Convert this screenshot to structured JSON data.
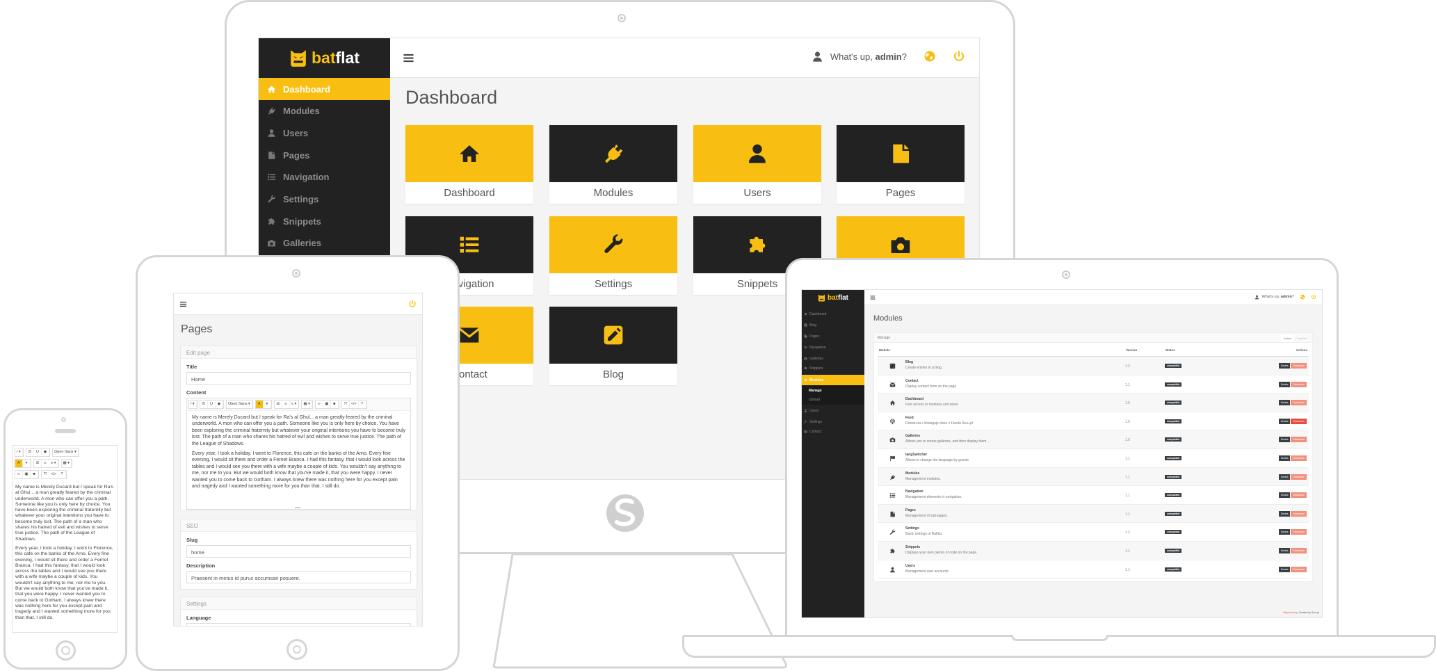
{
  "colors": {
    "accent": "#f8bf12",
    "dark": "#222222",
    "device_frame": "#d5d5d5",
    "deactivate": "#f0907e",
    "deactivate_strong": "#e74c3c"
  },
  "brand": {
    "part1": "bat",
    "part2": "flat"
  },
  "monitor": {
    "sidebar": [
      {
        "label": "Dashboard",
        "icon": "home",
        "active": true
      },
      {
        "label": "Modules",
        "icon": "plug"
      },
      {
        "label": "Users",
        "icon": "user"
      },
      {
        "label": "Pages",
        "icon": "file"
      },
      {
        "label": "Navigation",
        "icon": "list"
      },
      {
        "label": "Settings",
        "icon": "wrench"
      },
      {
        "label": "Snippets",
        "icon": "puzzle"
      },
      {
        "label": "Galleries",
        "icon": "camera"
      }
    ],
    "header": {
      "greeting_prefix": "What's up, ",
      "username": "admin",
      "greeting_suffix": "?",
      "user_icon": "user",
      "globe_icon": "globe",
      "power_icon": "power"
    },
    "title": "Dashboard",
    "tiles": [
      {
        "label": "Dashboard",
        "icon": "home",
        "style": "yellow"
      },
      {
        "label": "Modules",
        "icon": "plug",
        "style": "dark"
      },
      {
        "label": "Users",
        "icon": "user",
        "style": "yellow"
      },
      {
        "label": "Pages",
        "icon": "file",
        "style": "dark"
      },
      {
        "label": "Navigation",
        "icon": "list",
        "style": "dark"
      },
      {
        "label": "Settings",
        "icon": "wrench",
        "style": "yellow"
      },
      {
        "label": "Snippets",
        "icon": "puzzle",
        "style": "dark"
      },
      {
        "label": "Galleries",
        "icon": "camera",
        "style": "yellow"
      },
      {
        "label": "Contact",
        "icon": "envelope",
        "style": "yellow"
      },
      {
        "label": "Blog",
        "icon": "pencil",
        "style": "dark"
      }
    ]
  },
  "editor": {
    "font_label": "Open Sans",
    "paragraphs": [
      "My name is Merely Ducard but I speak for Ra's al Ghul... a man greatly feared by the criminal underworld. A mon who can offer you a path. Someone like you is only here by choice. You have been exploring the criminal fraternity but whatever your original intentions you have to become truly lost. The path of a man who shares his hatred of evil and wishes to serve true justice. The path of the League of Shadows.",
      "Every year, I took a holiday. I went to Florence, this cafe on the banks of the Arno. Every fine evening, I would sit there and order a Fernet Branca. I had this fantasy, that I would look across the tables and I would see you there with a wife maybe a couple of kids. You wouldn't say anything to me, nor me to you. But we would both know that you've made it, that you were happy. I never wanted you to come back to Gotham. I always knew there was nothing here for you except pain and tragedy and I wanted something more for you than that. I still do."
    ],
    "toolbar": [
      [
        {
          "icon": "magic",
          "caret": true
        }
      ],
      [
        {
          "text": "B"
        },
        {
          "text": "U"
        },
        {
          "icon": "eraser"
        }
      ],
      [
        {
          "text": "Open Sans",
          "caret": true
        }
      ],
      [
        {
          "text": "A",
          "highlight": true
        },
        {
          "caret": true
        }
      ],
      [
        {
          "icon": "unordered-list"
        },
        {
          "icon": "ordered-list"
        },
        {
          "icon": "align",
          "caret": true
        }
      ],
      [
        {
          "icon": "table",
          "caret": true
        }
      ],
      [
        {
          "icon": "link"
        },
        {
          "icon": "picture"
        },
        {
          "icon": "video"
        }
      ],
      [
        {
          "icon": "fullscreen"
        },
        {
          "text": "</>"
        },
        {
          "text": "?"
        }
      ]
    ]
  },
  "tablet": {
    "title": "Pages",
    "edit_panel": {
      "heading": "Edit page",
      "title_label": "Title",
      "title_value": "Home",
      "content_label": "Content"
    },
    "seo_panel": {
      "heading": "SEO",
      "slug_label": "Slug",
      "slug_value": "home",
      "description_label": "Description",
      "description_value": "Praesent in metus id purus accumsan posuere."
    },
    "settings_panel": {
      "heading": "Settings",
      "language_label": "Language"
    }
  },
  "laptop": {
    "sidebar": [
      {
        "label": "Dashboard",
        "icon": "home"
      },
      {
        "label": "Blog",
        "icon": "pencil"
      },
      {
        "label": "Pages",
        "icon": "file"
      },
      {
        "label": "Navigation",
        "icon": "list"
      },
      {
        "label": "Galleries",
        "icon": "camera"
      },
      {
        "label": "Snippets",
        "icon": "puzzle"
      },
      {
        "label": "Modules",
        "icon": "plug",
        "active": true
      },
      {
        "label": "Manage",
        "sub": true,
        "current": true
      },
      {
        "label": "Upload",
        "sub": true
      },
      {
        "label": "Users",
        "icon": "user"
      },
      {
        "label": "Settings",
        "icon": "wrench"
      },
      {
        "label": "Contact",
        "icon": "envelope"
      }
    ],
    "title": "Modules",
    "panel_heading": "Manage",
    "tabs": [
      {
        "label": "Active",
        "active": true
      },
      {
        "label": "Inactive"
      }
    ],
    "columns": [
      "Module",
      "Version",
      "Status",
      "Actions"
    ],
    "details_label": "Details",
    "deactivate_label": "Deactivate",
    "modules": [
      {
        "name": "Blog",
        "desc": "Create entries in a blog.",
        "version": "1.2",
        "status": "compatible",
        "icon": "pencil"
      },
      {
        "name": "Contact",
        "desc": "Display contact form on the page.",
        "version": "1.1",
        "status": "compatible",
        "icon": "envelope"
      },
      {
        "name": "Dashboard",
        "desc": "Fast access to modules and news.",
        "version": "1.0",
        "status": "compatible",
        "icon": "home"
      },
      {
        "name": "Feed",
        "desc": "Dostarcza i obsługuje dane z Feeda Sruu.pl",
        "version": "1.0",
        "status": "compatible",
        "icon": "rss",
        "deactivate_strong": true
      },
      {
        "name": "Galleries",
        "desc": "Allows you to create galleries, and then display them ...",
        "version": "1.0",
        "status": "compatible",
        "icon": "camera"
      },
      {
        "name": "langSwitcher",
        "desc": "Allows to change the language by guests.",
        "version": "1.1",
        "status": "compatible",
        "icon": "flag"
      },
      {
        "name": "Modules",
        "desc": "Management modules.",
        "version": "1.1",
        "status": "compatible",
        "icon": "plug"
      },
      {
        "name": "Navigation",
        "desc": "Management elements in navigation.",
        "version": "1.1",
        "status": "compatible",
        "icon": "list"
      },
      {
        "name": "Pages",
        "desc": "Management of sub-pages.",
        "version": "1.1",
        "status": "compatible",
        "icon": "file"
      },
      {
        "name": "Settings",
        "desc": "Basic settings of Batflat.",
        "version": "1.2",
        "status": "compatible",
        "icon": "wrench"
      },
      {
        "name": "Snippets",
        "desc": "Displays your own pieces of code on the page.",
        "version": "1.1",
        "status": "compatible",
        "icon": "puzzle"
      },
      {
        "name": "Users",
        "desc": "Management user accounts.",
        "version": "1.1",
        "status": "compatible",
        "icon": "user"
      }
    ],
    "footer": {
      "report": "Report a bug.",
      "credit": " Created by Sruu.pl"
    }
  }
}
